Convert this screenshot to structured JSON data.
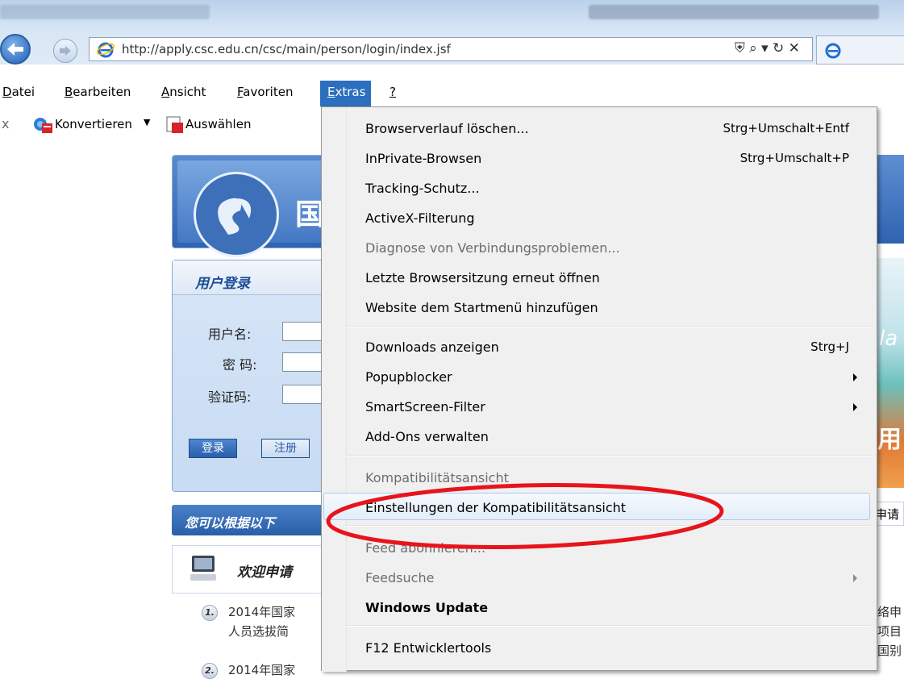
{
  "browser": {
    "url": "http://apply.csc.edu.cn/csc/main/person/login/index.jsf",
    "address_tools": "⛨ ⌕ ▾ ↻ ✕",
    "back_icon": "back-arrow-icon",
    "forward_icon": "forward-arrow-icon"
  },
  "menubar": {
    "items": [
      {
        "label": "Datei"
      },
      {
        "label": "Bearbeiten"
      },
      {
        "label": "Ansicht"
      },
      {
        "label": "Favoriten"
      },
      {
        "label": "Extras"
      },
      {
        "label": "?"
      }
    ]
  },
  "toolbar": {
    "close_glyph": "x",
    "convert_label": "Konvertieren",
    "select_label": "Auswählen"
  },
  "page": {
    "login_title": "用户登录",
    "username_label": "用户名:",
    "password_label": "密 码:",
    "captcha_label": "验证码:",
    "login_button": "登录",
    "register_button": "注册",
    "info_bar": "您可以根据以下",
    "welcome": "欢迎申请",
    "logo_char": "国",
    "news": [
      {
        "num": "1.",
        "line1": "2014年国家",
        "line2": "人员选拔简"
      },
      {
        "num": "2.",
        "line1": "2014年国家",
        "line2": ""
      }
    ],
    "right_fragments": {
      "la": "la",
      "pic_char": "用",
      "apply": "申请",
      "lines": [
        "络申",
        "项目",
        "国别"
      ]
    }
  },
  "dropdown": {
    "items": [
      {
        "label": "Browserverlauf löschen...",
        "shortcut": "Strg+Umschalt+Entf",
        "disabled": false,
        "submenu": false
      },
      {
        "label": "InPrivate-Browsen",
        "shortcut": "Strg+Umschalt+P",
        "disabled": false,
        "submenu": false
      },
      {
        "label": "Tracking-Schutz...",
        "shortcut": "",
        "disabled": false,
        "submenu": false
      },
      {
        "label": "ActiveX-Filterung",
        "shortcut": "",
        "disabled": false,
        "submenu": false
      },
      {
        "label": "Diagnose von Verbindungsproblemen...",
        "shortcut": "",
        "disabled": true,
        "submenu": false
      },
      {
        "label": "Letzte Browsersitzung erneut öffnen",
        "shortcut": "",
        "disabled": false,
        "submenu": false
      },
      {
        "label": "Website dem Startmenü hinzufügen",
        "shortcut": "",
        "disabled": false,
        "submenu": false
      },
      {
        "label": "Downloads anzeigen",
        "shortcut": "Strg+J",
        "disabled": false,
        "submenu": false
      },
      {
        "label": "Popupblocker",
        "shortcut": "",
        "disabled": false,
        "submenu": true
      },
      {
        "label": "SmartScreen-Filter",
        "shortcut": "",
        "disabled": false,
        "submenu": true
      },
      {
        "label": "Add-Ons verwalten",
        "shortcut": "",
        "disabled": false,
        "submenu": false
      },
      {
        "label": "Kompatibilitätsansicht",
        "shortcut": "",
        "disabled": true,
        "submenu": false
      },
      {
        "label": "Einstellungen der Kompatibilitätsansicht",
        "shortcut": "",
        "disabled": false,
        "submenu": false,
        "highlighted": true
      },
      {
        "label": "Feed abonnieren...",
        "shortcut": "",
        "disabled": true,
        "submenu": false
      },
      {
        "label": "Feedsuche",
        "shortcut": "",
        "disabled": true,
        "submenu": true
      },
      {
        "label": "Windows Update",
        "shortcut": "",
        "disabled": false,
        "submenu": false
      },
      {
        "label": "F12 Entwicklertools",
        "shortcut": "",
        "disabled": false,
        "submenu": false
      }
    ]
  },
  "annotation": {
    "color": "#e8141b"
  }
}
